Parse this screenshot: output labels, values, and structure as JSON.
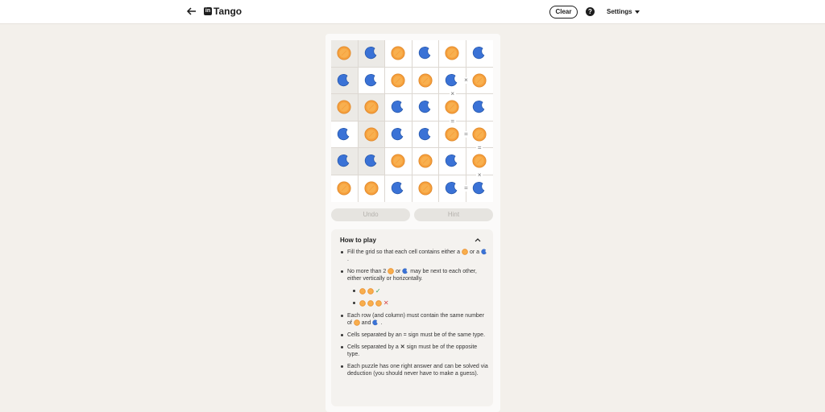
{
  "header": {
    "title": "Tango",
    "logo_text": "in",
    "clear_label": "Clear",
    "help_label": "?",
    "settings_label": "Settings"
  },
  "board": {
    "rows": [
      [
        "sun",
        "moon",
        "sun",
        "moon",
        "sun",
        "moon"
      ],
      [
        "moon",
        "moon",
        "sun",
        "sun",
        "moon",
        "sun"
      ],
      [
        "sun",
        "sun",
        "moon",
        "moon",
        "sun",
        "moon"
      ],
      [
        "moon",
        "sun",
        "moon",
        "moon",
        "sun",
        "sun"
      ],
      [
        "moon",
        "moon",
        "sun",
        "sun",
        "moon",
        "sun"
      ],
      [
        "sun",
        "sun",
        "moon",
        "sun",
        "moon",
        "moon"
      ]
    ],
    "locked": [
      [
        true,
        true,
        false,
        false,
        false,
        false
      ],
      [
        true,
        false,
        false,
        false,
        false,
        false
      ],
      [
        true,
        true,
        false,
        false,
        false,
        false
      ],
      [
        false,
        true,
        false,
        false,
        false,
        false
      ],
      [
        true,
        true,
        false,
        false,
        false,
        false
      ],
      [
        false,
        false,
        false,
        false,
        false,
        false
      ]
    ],
    "constraints": [
      {
        "sign": "×",
        "between": [
          [
            1,
            4
          ],
          [
            1,
            5
          ]
        ]
      },
      {
        "sign": "×",
        "between": [
          [
            1,
            4
          ],
          [
            2,
            4
          ]
        ]
      },
      {
        "sign": "=",
        "between": [
          [
            2,
            4
          ],
          [
            3,
            4
          ]
        ]
      },
      {
        "sign": "=",
        "between": [
          [
            3,
            4
          ],
          [
            3,
            5
          ]
        ]
      },
      {
        "sign": "=",
        "between": [
          [
            3,
            5
          ],
          [
            4,
            5
          ]
        ]
      },
      {
        "sign": "×",
        "between": [
          [
            4,
            5
          ],
          [
            5,
            5
          ]
        ]
      },
      {
        "sign": "=",
        "between": [
          [
            5,
            4
          ],
          [
            5,
            5
          ]
        ]
      }
    ],
    "colors": {
      "sun": "#f6a03d",
      "moon": "#3a72d6"
    }
  },
  "actions": {
    "undo_label": "Undo",
    "hint_label": "Hint"
  },
  "how_to_play": {
    "title": "How to play",
    "rule1_a": "Fill the grid so that each cell contains either a",
    "rule1_b": "or a",
    "rule2_a": "No more than 2",
    "rule2_b": "or",
    "rule2_c": "may be next to each other, either vertically or horizontally.",
    "rule3_a": "Each row (and column) must contain the same number of",
    "rule3_b": "and",
    "rule4": "Cells separated by an = sign must be of the same type.",
    "rule5_a": "Cells separated by a",
    "rule5_b": "sign must be of the opposite type.",
    "rule6": "Each puzzle has one right answer and can be solved via deduction (you should never have to make a guess).",
    "ok_mark": "✓",
    "bad_mark": "✕"
  }
}
